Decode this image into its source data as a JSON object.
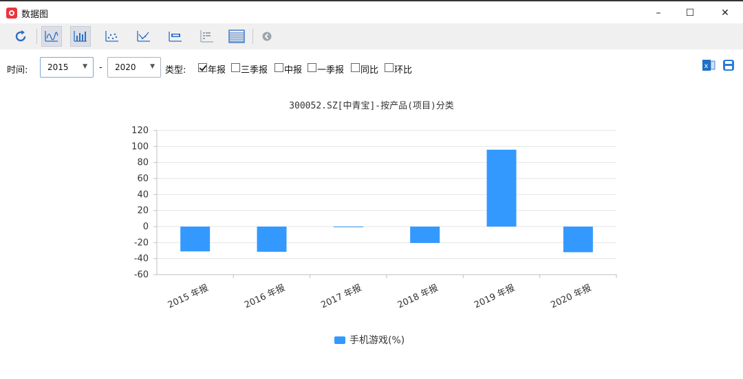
{
  "window": {
    "title": "数据图",
    "controls": {
      "minimize": "–",
      "maximize": "☐",
      "close": "✕"
    }
  },
  "toolbar": {
    "buttons": [
      "refresh-icon",
      "line-chart-icon",
      "bar-chart-icon",
      "scatter-chart-icon",
      "trend-chart-icon",
      "data-label-icon",
      "legend-icon",
      "table-icon",
      "back-icon"
    ],
    "active": [
      "line-chart-icon",
      "bar-chart-icon"
    ]
  },
  "filters": {
    "time_label": "时间:",
    "start_year": "2015",
    "separator": "-",
    "end_year": "2020",
    "type_label": "类型:",
    "types": [
      {
        "label": "年报",
        "checked": true
      },
      {
        "label": "三季报",
        "checked": false
      },
      {
        "label": "中报",
        "checked": false
      },
      {
        "label": "一季报",
        "checked": false
      },
      {
        "label": "同比",
        "checked": false
      },
      {
        "label": "环比",
        "checked": false
      }
    ]
  },
  "colors": {
    "bar": "#3399ff",
    "grid": "#e6e6e6",
    "axis": "#bfbfbf",
    "tick": "#333333",
    "excel": "#1f6fc5",
    "save": "#2b7bd6"
  },
  "chart_data": {
    "type": "bar",
    "title": "300052.SZ[中青宝]-按产品(项目)分类",
    "categories": [
      "2015 年报",
      "2016 年报",
      "2017 年报",
      "2018 年报",
      "2019 年报",
      "2020 年报"
    ],
    "series": [
      {
        "name": "手机游戏(%)",
        "values": [
          -31,
          -31.5,
          -0.5,
          -20.5,
          96,
          -32
        ]
      }
    ],
    "ylim": [
      -60,
      120
    ],
    "yticks": [
      120,
      100,
      80,
      60,
      40,
      20,
      0,
      -20,
      -40,
      -60
    ],
    "grid": true,
    "legend_position": "bottom-center"
  }
}
